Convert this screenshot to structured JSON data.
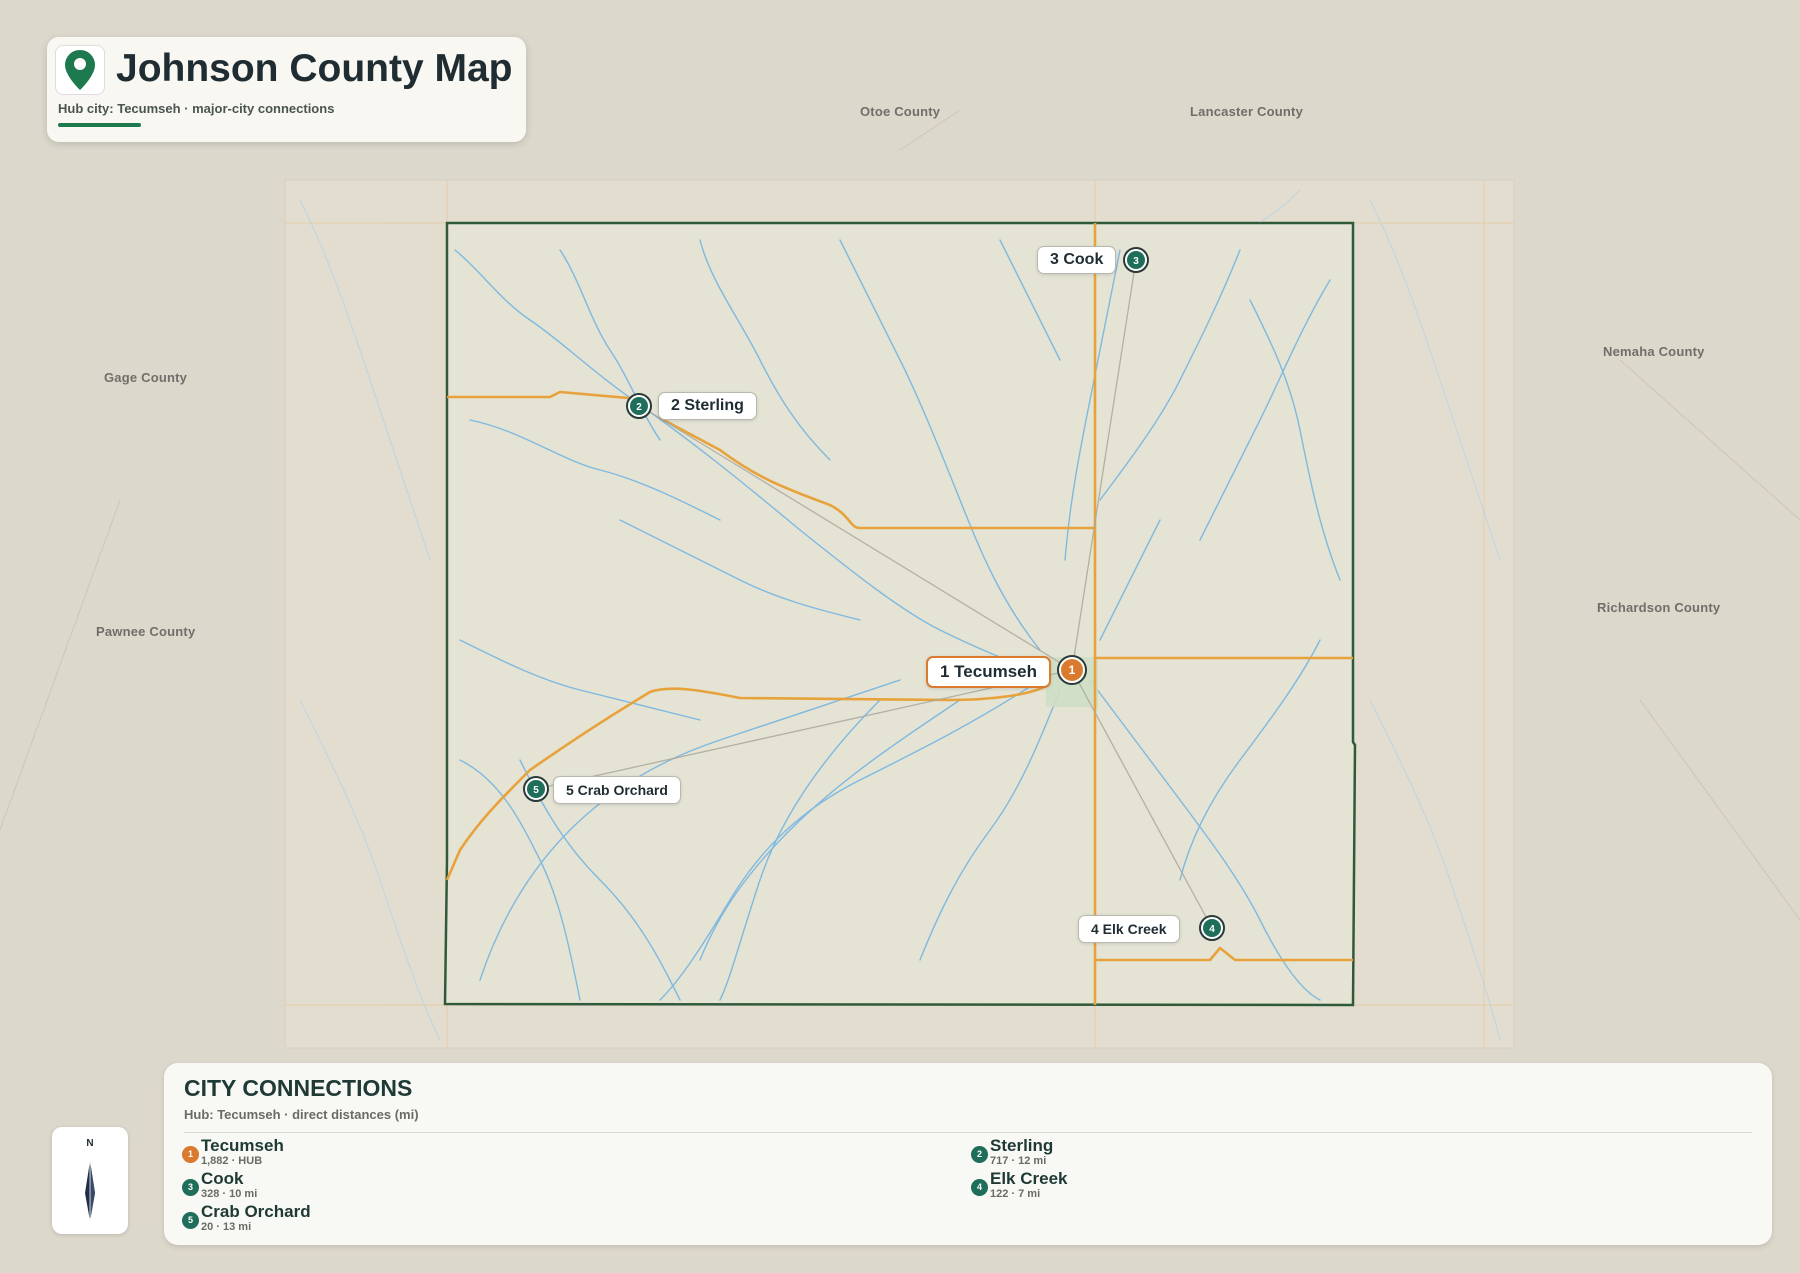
{
  "title": {
    "text": "Johnson County Map",
    "subtitle": "Hub city: Tecumseh · major-city connections",
    "icon": "map-pin-icon"
  },
  "neighbors": [
    {
      "name": "Otoe County"
    },
    {
      "name": "Lancaster County"
    },
    {
      "name": "Gage County"
    },
    {
      "name": "Nemaha County"
    },
    {
      "name": "Pawnee County"
    },
    {
      "name": "Richardson County"
    }
  ],
  "cities": [
    {
      "num": "1",
      "name": "Tecumseh",
      "label": "1 Tecumseh",
      "hub": true
    },
    {
      "num": "2",
      "name": "Sterling",
      "label": "2 Sterling",
      "hub": false
    },
    {
      "num": "3",
      "name": "Cook",
      "label": "3 Cook",
      "hub": false
    },
    {
      "num": "4",
      "name": "Elk Creek",
      "label": "4 Elk Creek",
      "hub": false
    },
    {
      "num": "5",
      "name": "Crab Orchard",
      "label": "5 Crab Orchard",
      "hub": false
    }
  ],
  "legend": {
    "title": "CITY CONNECTIONS",
    "subtitle": "Hub: Tecumseh · direct distances (mi)",
    "items": [
      {
        "num": "1",
        "name": "Tecumseh",
        "detail": "1,882 · HUB"
      },
      {
        "num": "2",
        "name": "Sterling",
        "detail": "717 · 12 mi"
      },
      {
        "num": "3",
        "name": "Cook",
        "detail": "328 · 10 mi"
      },
      {
        "num": "4",
        "name": "Elk Creek",
        "detail": "122 · 7 mi"
      },
      {
        "num": "5",
        "name": "Crab Orchard",
        "detail": "20 · 13 mi"
      }
    ]
  },
  "compass": {
    "north": "N"
  },
  "colors": {
    "hub": "#d97a2e",
    "city": "#1e6e5a",
    "road": "#e8a23c",
    "river": "#7fb9e0",
    "boundary": "#2f5a3a",
    "county_fill": "#e4e3d4"
  }
}
